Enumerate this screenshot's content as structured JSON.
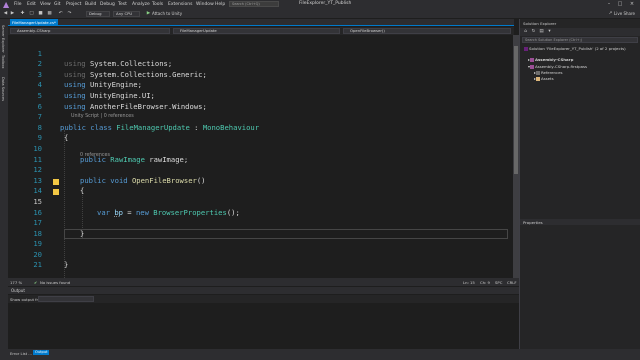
{
  "app": {
    "window_title": "FileExplorer_YT_Publish",
    "search_placeholder": "Search (Ctrl+Q)",
    "menu": [
      "File",
      "Edit",
      "View",
      "Git",
      "Project",
      "Build",
      "Debug",
      "Test",
      "Analyze",
      "Tools",
      "Extensions",
      "Window",
      "Help"
    ],
    "live_share": "Live Share"
  },
  "toolbar": {
    "config": "Debug",
    "platform": "Any CPU",
    "attach": "Attach to Unity"
  },
  "left_strip": [
    "Server Explorer",
    "Toolbox",
    "Data Sources"
  ],
  "document": {
    "tab_label": "FileManagerUpdate.cs*",
    "nav_project": "Assembly-CSharp",
    "nav_class": "FileManagerUpdate",
    "nav_member": "OpenFileBrowser()"
  },
  "code": {
    "l1": [
      "using",
      "System.Collections;"
    ],
    "l2": [
      "using",
      "System.Collections.Generic;"
    ],
    "l3": [
      "using",
      "UnityEngine;"
    ],
    "l4": [
      "using",
      "UnityEngine.UI;"
    ],
    "l5": [
      "using",
      "AnotherFileBrowser.Windows;"
    ],
    "lens_class": "Unity Script | 0 references",
    "l7": [
      "public class",
      "FileManagerUpdate",
      ":",
      "MonoBehaviour"
    ],
    "l8": "{",
    "l10": [
      "public",
      "RawImage",
      "rawImage;"
    ],
    "lens_method": "0 references",
    "l12": [
      "public void",
      "OpenFileBrowser",
      "()"
    ],
    "l13": "{",
    "l14": [
      "var",
      "bp",
      "=",
      "new",
      "BrowserProperties",
      "();"
    ],
    "l16": "}",
    "l18": "}",
    "line_numbers": [
      "1",
      "2",
      "3",
      "4",
      "5",
      "6",
      "7",
      "8",
      "9",
      "10",
      "11",
      "12",
      "13",
      "14",
      "15",
      "16",
      "17",
      "18",
      "19",
      "20",
      "21"
    ]
  },
  "editor_status": {
    "zoom": "177 %",
    "issues": "No issues found",
    "position": "Ln: 15",
    "col": "Ch: 9",
    "spc": "SPC",
    "eol": "CRLF"
  },
  "output_panel": {
    "title": "Output",
    "source_label": "Show output from:"
  },
  "bottom_tabs": [
    "Error List ...",
    "Output"
  ],
  "solution_explorer": {
    "title": "Solution Explorer",
    "search_placeholder": "Search Solution Explorer (Ctrl+;)",
    "items": [
      "Solution 'FileExplorer_YT_Publish' (2 of 2 projects)",
      "Assembly-CSharp",
      "Assembly-CSharp-firstpass",
      "References",
      "Assets"
    ]
  },
  "properties": {
    "title": "Properties"
  },
  "colors": {
    "accent": "#007acc",
    "keyword": "#569cd6",
    "type": "#4ec9b0",
    "method": "#dcdcaa",
    "background": "#1e1e1e"
  }
}
